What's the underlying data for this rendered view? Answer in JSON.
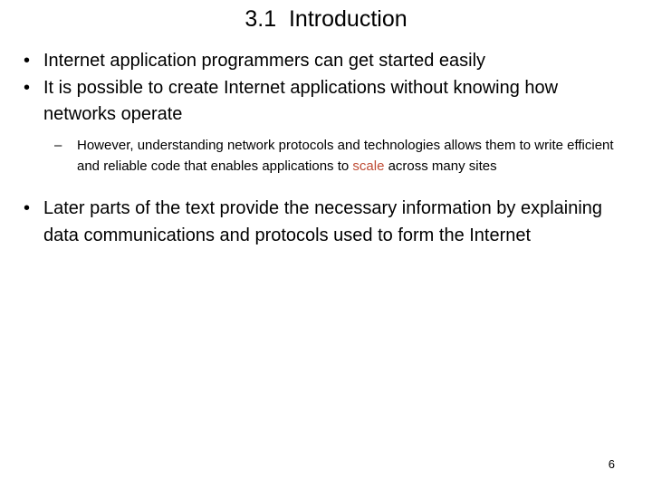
{
  "slide": {
    "title": "3.1  Introduction",
    "background_color": "#ffffff",
    "text_color": "#000000",
    "highlight_color": "#BE4B34",
    "page_number": "6",
    "bullets": [
      {
        "level": 1,
        "marker": "•",
        "text": "Internet application programmers can get started easily"
      },
      {
        "level": 1,
        "marker": "•",
        "text": "It is possible to create Internet applications without knowing how networks operate"
      },
      {
        "level": 2,
        "marker": "–",
        "text_before_highlight": "However, understanding network protocols and technologies allows them to write efficient and reliable code that enables applications to ",
        "highlight": "scale",
        "text_after_highlight": " across many sites"
      },
      {
        "level": 1,
        "marker": "•",
        "text": "Later parts of the text provide the necessary information by explaining data communications and protocols used to form the Internet"
      }
    ]
  }
}
